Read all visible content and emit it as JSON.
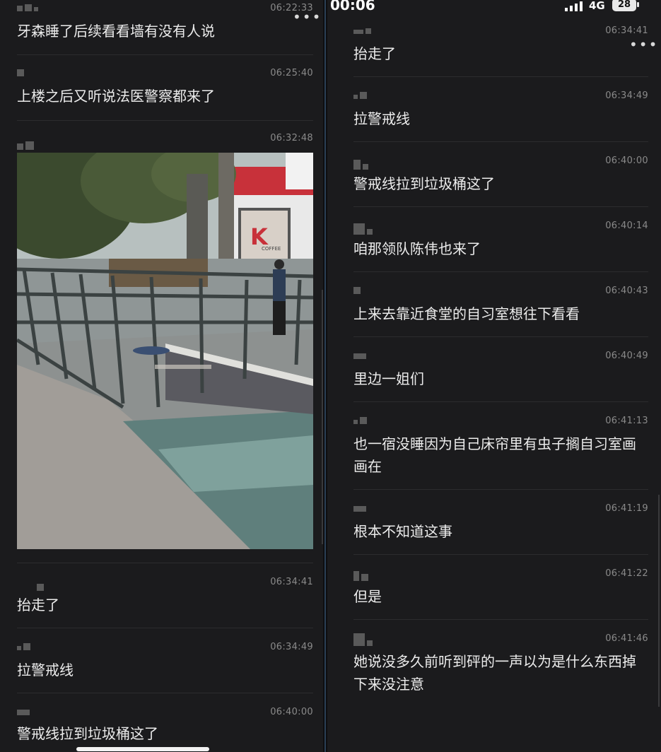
{
  "left_pane": {
    "messages": [
      {
        "time": "06:22:33",
        "text": "牙森睡了后续看看墙有没有人说"
      },
      {
        "time": "06:25:40",
        "text": "上楼之后又听说法医警察都来了"
      },
      {
        "time": "06:32:48",
        "text": ""
      },
      {
        "time": "06:34:41",
        "text": "抬走了"
      },
      {
        "time": "06:34:49",
        "text": "拉警戒线"
      },
      {
        "time": "06:40:00",
        "text": "警戒线拉到垃圾桶这了"
      }
    ],
    "more_label": "•••",
    "photo_sign_letter": "K",
    "photo_sign_word": "COFFEE"
  },
  "right_pane": {
    "status_bar": {
      "clock": "00:06",
      "network": "4G",
      "battery": "28"
    },
    "more_label": "•••",
    "messages": [
      {
        "time": "06:34:41",
        "text": "抬走了"
      },
      {
        "time": "06:34:49",
        "text": "拉警戒线"
      },
      {
        "time": "06:40:00",
        "text": "警戒线拉到垃圾桶这了"
      },
      {
        "time": "06:40:14",
        "text": "咱那领队陈伟也来了"
      },
      {
        "time": "06:40:43",
        "text": "上来去靠近食堂的自习室想往下看看"
      },
      {
        "time": "06:40:49",
        "text": "里边一姐们"
      },
      {
        "time": "06:41:13",
        "text": "也一宿没睡因为自己床帘里有虫子搁自习室画画在"
      },
      {
        "time": "06:41:19",
        "text": "根本不知道这事"
      },
      {
        "time": "06:41:22",
        "text": "但是"
      },
      {
        "time": "06:41:46",
        "text": "她说没多久前听到砰的一声以为是什么东西掉下来没注意"
      }
    ]
  }
}
